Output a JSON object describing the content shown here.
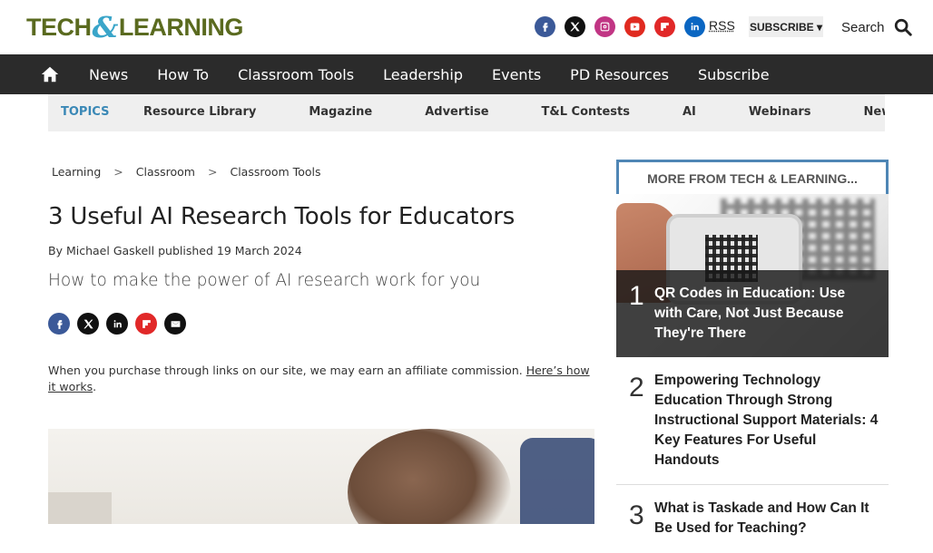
{
  "header": {
    "logo_left": "TECH",
    "logo_amp": "&",
    "logo_right": "LEARNING",
    "rss_label": "RSS",
    "subscribe_label": "SUBSCRIBE ▾",
    "search_label": "Search"
  },
  "social": [
    {
      "name": "facebook",
      "color": "#3b5998"
    },
    {
      "name": "x",
      "color": "#111111"
    },
    {
      "name": "instagram",
      "color": "#c13584"
    },
    {
      "name": "youtube",
      "color": "#e02a20"
    },
    {
      "name": "flipboard",
      "color": "#e12828"
    },
    {
      "name": "linkedin",
      "color": "#0a66c2"
    }
  ],
  "nav": {
    "home_icon": "home-icon",
    "items": [
      "News",
      "How To",
      "Classroom Tools",
      "Leadership",
      "Events",
      "PD Resources",
      "Subscribe"
    ]
  },
  "topics": {
    "label": "TOPICS",
    "items": [
      "Resource Library",
      "Magazine",
      "Advertise",
      "T&L Contests",
      "AI",
      "Webinars",
      "News Sig"
    ]
  },
  "breadcrumb": [
    "Learning",
    "Classroom",
    "Classroom Tools"
  ],
  "breadcrumb_sep": ">",
  "article": {
    "title": "3 Useful AI Research Tools for Educators",
    "byline_prefix": "By",
    "author": "Michael Gaskell",
    "published_prefix": "published",
    "date": "19 March 2024",
    "subtitle": "How to make the power of AI research work for you",
    "affiliate_text": "When you purchase through links on our site, we may earn an affiliate commission.",
    "affiliate_link": "Here’s how it works",
    "affiliate_end": "."
  },
  "share": [
    {
      "name": "facebook",
      "color": "#3b5998"
    },
    {
      "name": "x",
      "color": "#111111"
    },
    {
      "name": "linkedin",
      "color": "#0a66c2"
    },
    {
      "name": "flipboard",
      "color": "#e12828"
    },
    {
      "name": "email",
      "color": "#111111"
    }
  ],
  "sidebar": {
    "heading": "MORE FROM TECH & LEARNING...",
    "items": [
      {
        "num": "1",
        "title": "QR Codes in Education: Use with Care, Not Just Because They're There"
      },
      {
        "num": "2",
        "title": "Empowering Technology Education Through Strong Instructional Support Materials: 4 Key Features For Useful Handouts"
      },
      {
        "num": "3",
        "title": "What is Taskade and How Can It Be Used for Teaching?"
      }
    ]
  }
}
